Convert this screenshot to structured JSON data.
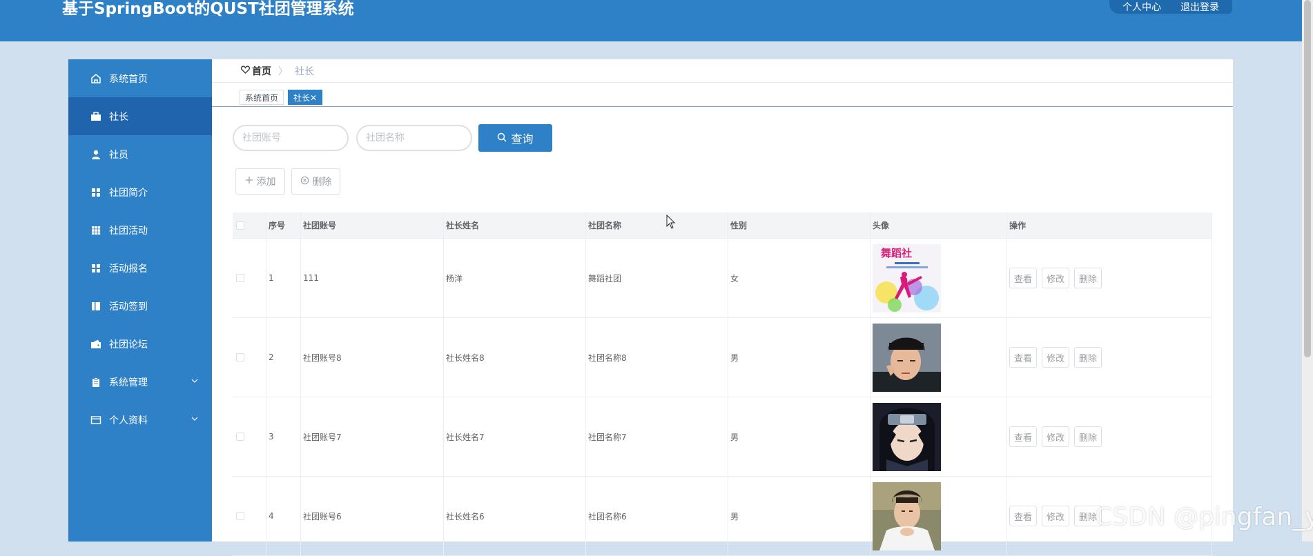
{
  "header": {
    "app_title": "基于SpringBoot的QUST社团管理系统",
    "actions": [
      "个人中心",
      "退出登录"
    ]
  },
  "sidebar": {
    "items": [
      {
        "label": "系统首页",
        "icon": "home-icon"
      },
      {
        "label": "社长",
        "icon": "briefcase-icon",
        "active": true
      },
      {
        "label": "社员",
        "icon": "user-icon"
      },
      {
        "label": "社团简介",
        "icon": "grid-icon"
      },
      {
        "label": "社团活动",
        "icon": "table-icon"
      },
      {
        "label": "活动报名",
        "icon": "grid-icon"
      },
      {
        "label": "活动签到",
        "icon": "book-icon"
      },
      {
        "label": "社团论坛",
        "icon": "wallet-icon"
      },
      {
        "label": "系统管理",
        "icon": "clipboard-icon",
        "has_submenu": true
      },
      {
        "label": "个人资料",
        "icon": "card-icon",
        "has_submenu": true
      }
    ]
  },
  "breadcrumb": {
    "home": "首页",
    "separator": "〉",
    "current": "社长"
  },
  "tabs": [
    {
      "label": "系统首页",
      "active": false
    },
    {
      "label": "社长✕",
      "active": true
    }
  ],
  "search": {
    "account_placeholder": "社团账号",
    "name_placeholder": "社团名称",
    "query_label": "查询"
  },
  "toolbar": {
    "add_label": "添加",
    "delete_label": "删除"
  },
  "table": {
    "columns": [
      "序号",
      "社团账号",
      "社长姓名",
      "社团名称",
      "性别",
      "头像",
      "操作"
    ],
    "rows": [
      {
        "index": "1",
        "account": "111",
        "president": "杨洋",
        "club": "舞蹈社团",
        "gender": "女",
        "avatar": "dance-club-poster"
      },
      {
        "index": "2",
        "account": "社团账号8",
        "president": "社长姓名8",
        "club": "社团名称8",
        "gender": "男",
        "avatar": "man-in-black-cap-photo"
      },
      {
        "index": "3",
        "account": "社团账号7",
        "president": "社长姓名7",
        "club": "社团名称7",
        "gender": "男",
        "avatar": "anime-ninja-portrait"
      },
      {
        "index": "4",
        "account": "社团账号6",
        "president": "社长姓名6",
        "club": "社团名称6",
        "gender": "男",
        "avatar": "young-man-white-shirt-photo"
      }
    ],
    "row_actions": [
      "查看",
      "修改",
      "删除"
    ]
  },
  "watermark": "CSDN @pingfan_yu",
  "colors": {
    "primary": "#2f81c7",
    "primary_dark": "#1f64ad",
    "page_bg": "#d0e0ee",
    "text": "#606266"
  }
}
